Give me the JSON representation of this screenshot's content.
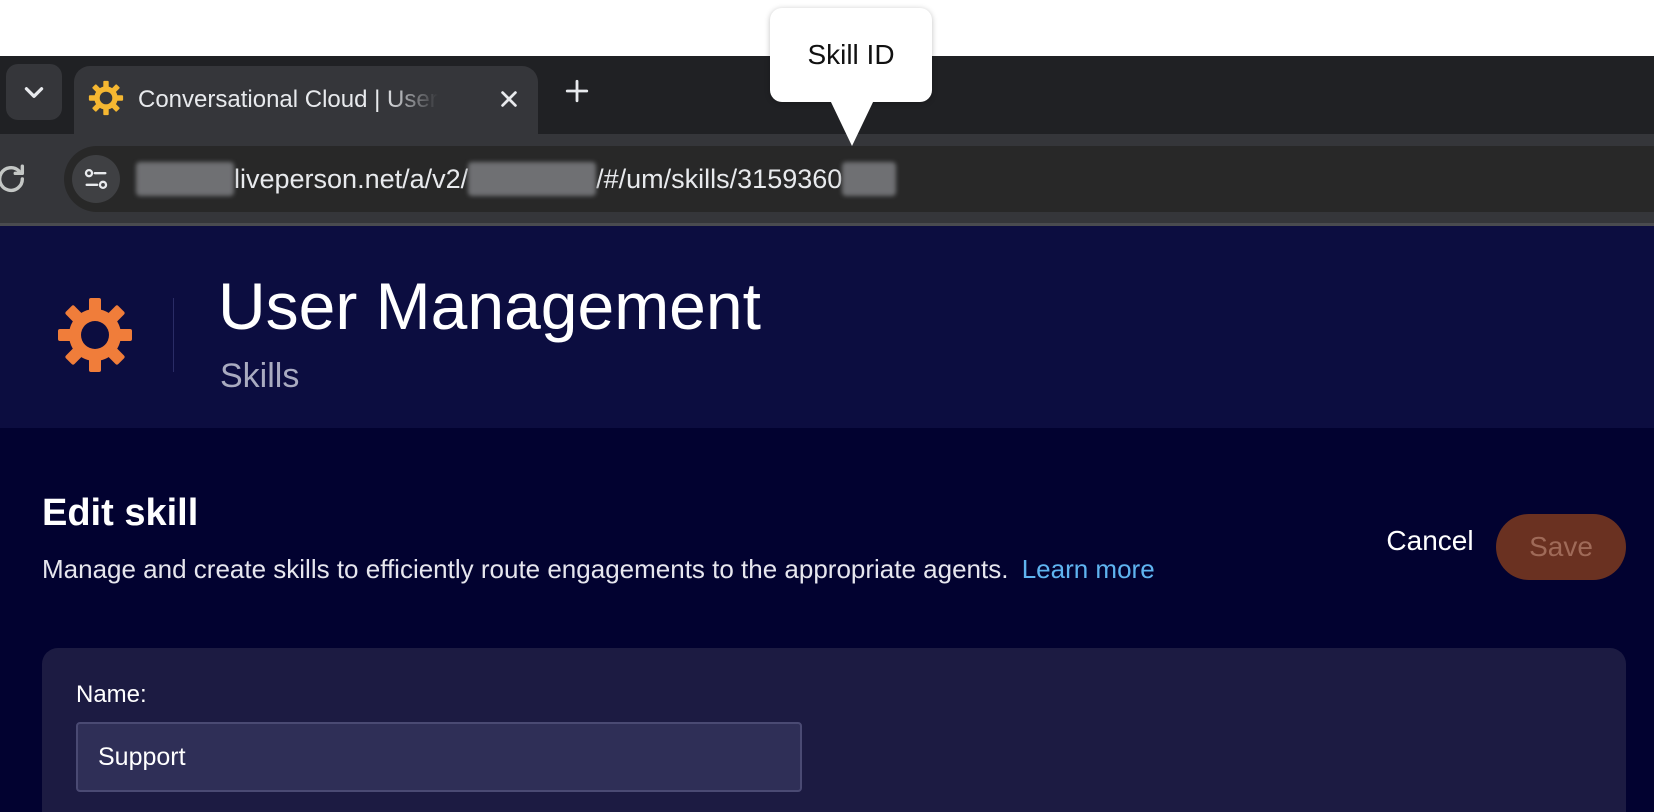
{
  "browser": {
    "tab_title": "Conversational Cloud | User Management",
    "url": {
      "part1": "liveperson.net/a/v2/",
      "part2": "/#/um/skills/3159360"
    },
    "tooltip": "Skill ID"
  },
  "header": {
    "title": "User Management",
    "subtitle": "Skills"
  },
  "page": {
    "title": "Edit skill",
    "description": "Manage and create skills to efficiently route engagements to the appropriate agents.",
    "learn_more": "Learn more",
    "cancel_label": "Cancel",
    "save_label": "Save"
  },
  "form": {
    "name_label": "Name:",
    "name_value": "Support"
  },
  "colors": {
    "brand_orange": "#f07d3a",
    "header_bg": "#0c0d40",
    "main_bg": "#020230",
    "link": "#5fb4f0"
  }
}
